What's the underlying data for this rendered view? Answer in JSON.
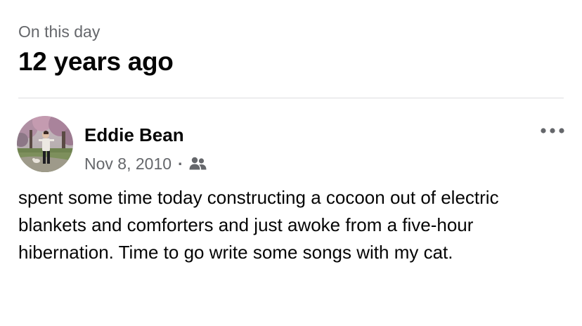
{
  "memory": {
    "kicker": "On this day",
    "headline": "12 years ago"
  },
  "post": {
    "author": "Eddie Bean",
    "date": "Nov 8, 2010",
    "separator": "·",
    "audience_icon": "friends-icon",
    "menu_icon": "more-options-icon",
    "avatar_icon": "profile-photo",
    "text": "spent some time today constructing a cocoon out of electric blankets and comforters and just awoke from a five-hour hibernation. Time to go write some songs with my cat."
  },
  "colors": {
    "primary_text": "#050505",
    "secondary_text": "#65676b",
    "divider": "#dcdde0",
    "background": "#ffffff"
  }
}
